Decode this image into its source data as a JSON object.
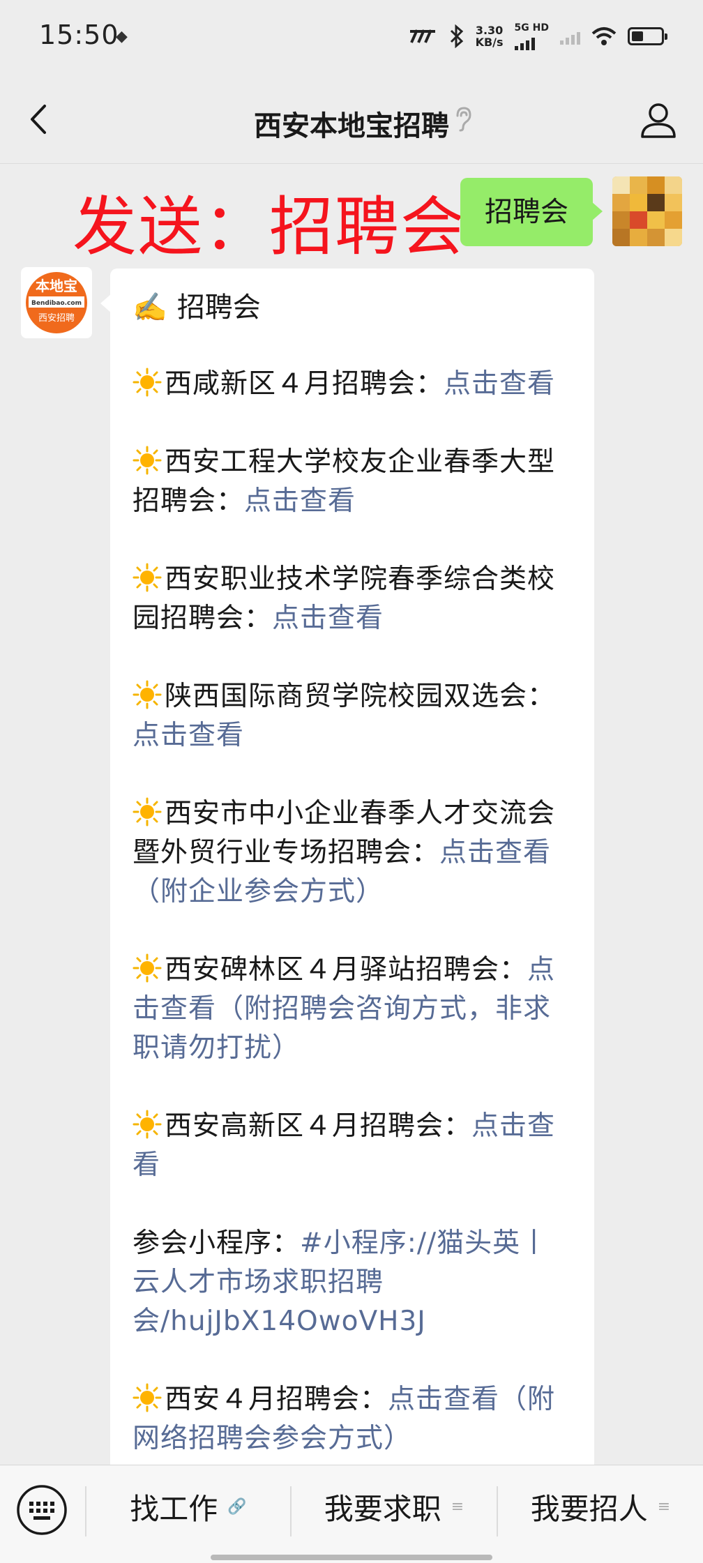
{
  "status_bar": {
    "time": "15:50",
    "speed_value": "3.30",
    "speed_unit": "KB/s",
    "network": "5G HD",
    "battery_level": 0.4
  },
  "header": {
    "back_icon": "chevron-left-icon",
    "title": "西安本地宝招聘",
    "listen_icon": "ear-icon",
    "profile_icon": "person-icon"
  },
  "chat": {
    "banner": "发送：招聘会",
    "sent_message": "招聘会",
    "bot_avatar": {
      "top_text": "本地宝",
      "domain": "Bendibao.com",
      "bottom_text": "西安招聘"
    },
    "reply": {
      "heading_icon": "✍️",
      "heading": "招聘会",
      "items": [
        {
          "icon": "sun-icon",
          "text": "西咸新区４月招聘会：",
          "link": "点击查看"
        },
        {
          "icon": "sun-icon",
          "text": "西安工程大学校友企业春季大型招聘会：",
          "link": "点击查看"
        },
        {
          "icon": "sun-icon",
          "text": "西安职业技术学院春季综合类校园招聘会：",
          "link": "点击查看"
        },
        {
          "icon": "sun-icon",
          "text": "陕西国际商贸学院校园双选会：",
          "link": "点击查看"
        },
        {
          "icon": "sun-icon",
          "text": "西安市中小企业春季人才交流会暨外贸行业专场招聘会：",
          "link": "点击查看（附企业参会方式）"
        },
        {
          "icon": "sun-icon",
          "text": "西安碑林区４月驿站招聘会：",
          "link": "点击查看（附招聘会咨询方式，非求职请勿打扰）"
        },
        {
          "icon": "sun-icon",
          "text": "西安高新区４月招聘会：",
          "link": "点击查看"
        },
        {
          "icon": "",
          "text": "参会小程序：",
          "link": "#小程序://猫头英丨云人才市场求职招聘会/hujJbX14OwoVH3J"
        },
        {
          "icon": "sun-icon",
          "text": "西安４月招聘会：",
          "link": "点击查看（附网络招聘会参会方式）"
        }
      ]
    }
  },
  "bottom_menu": {
    "keyboard_icon": "keyboard-icon",
    "items": [
      {
        "label": "找工作",
        "suffix_icon": "link-icon",
        "suffix": "🔗"
      },
      {
        "label": "我要求职",
        "suffix_icon": "menu-lines-icon",
        "suffix": "≡"
      },
      {
        "label": "我要招人",
        "suffix_icon": "menu-lines-icon",
        "suffix": "≡"
      }
    ]
  },
  "colors": {
    "banner_red": "#f5141d",
    "sent_bubble_green": "#95ec69",
    "link_blue": "#576b95",
    "logo_orange": "#f06a1c"
  }
}
